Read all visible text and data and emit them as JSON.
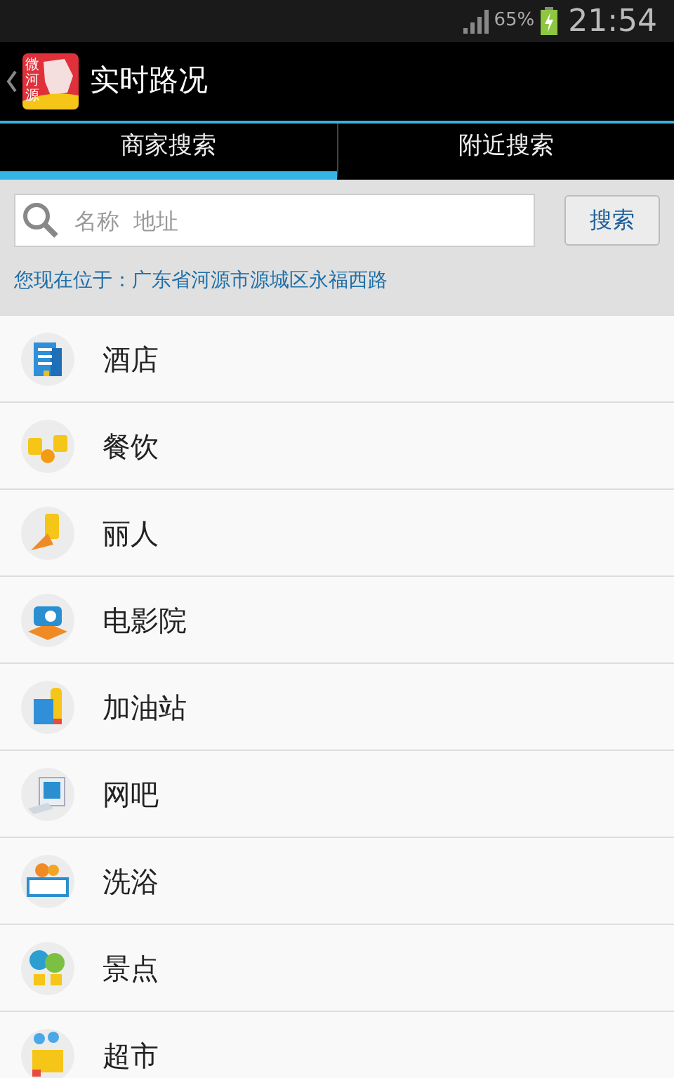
{
  "status_bar": {
    "battery_percent": "65%",
    "time": "21:54"
  },
  "action_bar": {
    "logo_text": "微河源",
    "title": "实时路况"
  },
  "tabs": [
    {
      "label": "商家搜索",
      "selected": true
    },
    {
      "label": "附近搜索",
      "selected": false
    }
  ],
  "search": {
    "placeholder": "名称  地址",
    "button": "搜索"
  },
  "location": "您现在位于：广东省河源市源城区永福西路",
  "categories": [
    {
      "label": "酒店",
      "kind": "hotel"
    },
    {
      "label": "餐饮",
      "kind": "food"
    },
    {
      "label": "丽人",
      "kind": "beauty"
    },
    {
      "label": "电影院",
      "kind": "cinema"
    },
    {
      "label": "加油站",
      "kind": "gas"
    },
    {
      "label": "网吧",
      "kind": "netcafe"
    },
    {
      "label": "洗浴",
      "kind": "bath"
    },
    {
      "label": "景点",
      "kind": "scenic"
    },
    {
      "label": "超市",
      "kind": "market"
    }
  ]
}
